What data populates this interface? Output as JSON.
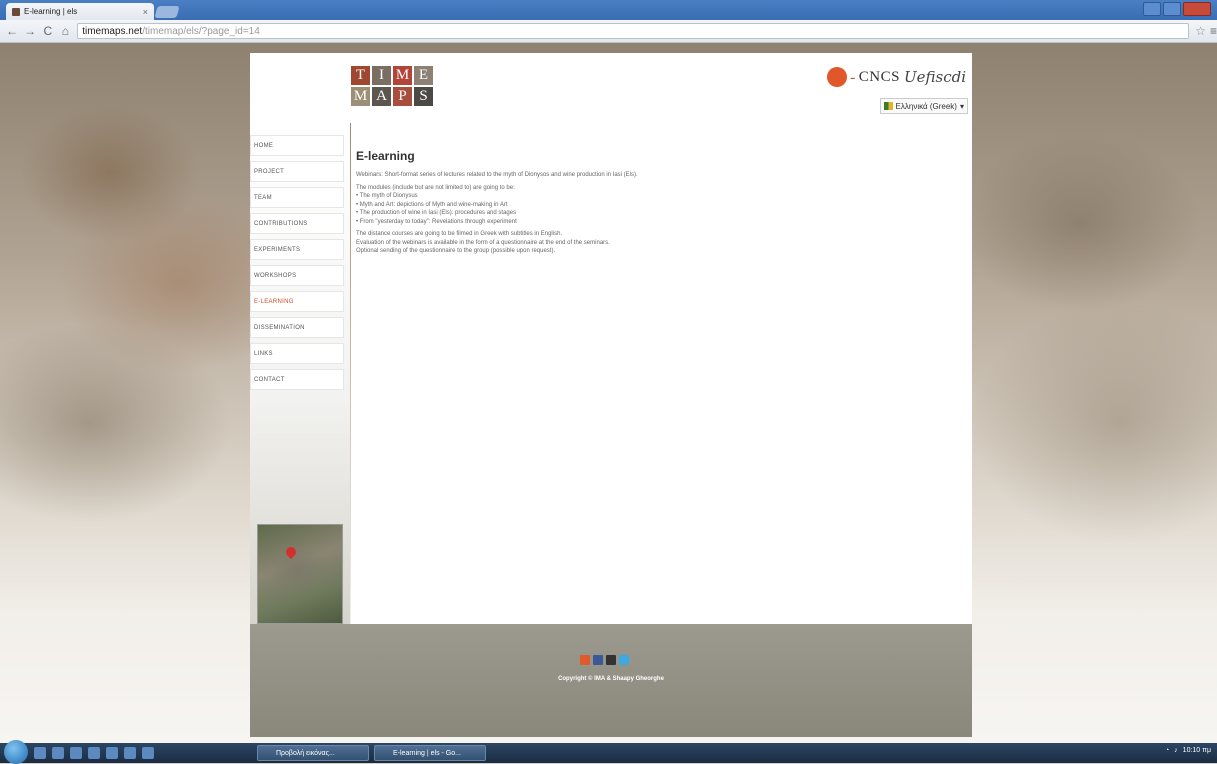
{
  "browser": {
    "tab_title": "E-learning | els",
    "url_host": "timemaps.net",
    "url_path": "/timemap/els/?page_id=14"
  },
  "header": {
    "logo_row1": [
      "T",
      "I",
      "M",
      "E"
    ],
    "logo_row2": [
      "M",
      "A",
      "P",
      "S"
    ],
    "partner_cncs": "CNCS",
    "partner_script": "Uefiscdi",
    "language": "Ελληνικά (Greek)"
  },
  "sidebar": {
    "items": [
      {
        "label": "HOME"
      },
      {
        "label": "PROJECT"
      },
      {
        "label": "TEAM"
      },
      {
        "label": "CONTRIBUTIONS"
      },
      {
        "label": "EXPERIMENTS"
      },
      {
        "label": "WORKSHOPS"
      },
      {
        "label": "E-LEARNING"
      },
      {
        "label": "DISSEMINATION"
      },
      {
        "label": "LINKS"
      },
      {
        "label": "CONTACT"
      }
    ],
    "active": "E-LEARNING"
  },
  "content": {
    "title": "E-learning",
    "paragraph1": "Webinars: Short-format series of lectures related to the myth of Dionysos and wine production in Iasi (Els).",
    "paragraph2_intro": "The modules (include but are not limited to) are going to be:",
    "bullets": [
      "• The myth of Dionysus",
      "• Myth and Art: depictions of Myth and wine-making in Art",
      "• The production of wine in Iasi (Els): procedures and stages",
      "• From \"yesterday to today\": Revelations through experiment"
    ],
    "paragraph3": "The distance courses are going to be filmed in Greek with subtitles in English.",
    "paragraph4": "Evaluation of the webinars is available in the form of a questionnaire at the end of the seminars.",
    "paragraph5": "Optional sending of the questionnaire to the group (possible upon request)."
  },
  "footer": {
    "copyright": "Copyright © IMA & Shaapy Gheorghe"
  },
  "taskbar": {
    "task1": "Προβολή εικόνας...",
    "task2": "E-learning | els - Go...",
    "clock": "10:10 πμ"
  },
  "colors": {
    "accent": "#d04a2a",
    "footer": "#8f8c80"
  }
}
